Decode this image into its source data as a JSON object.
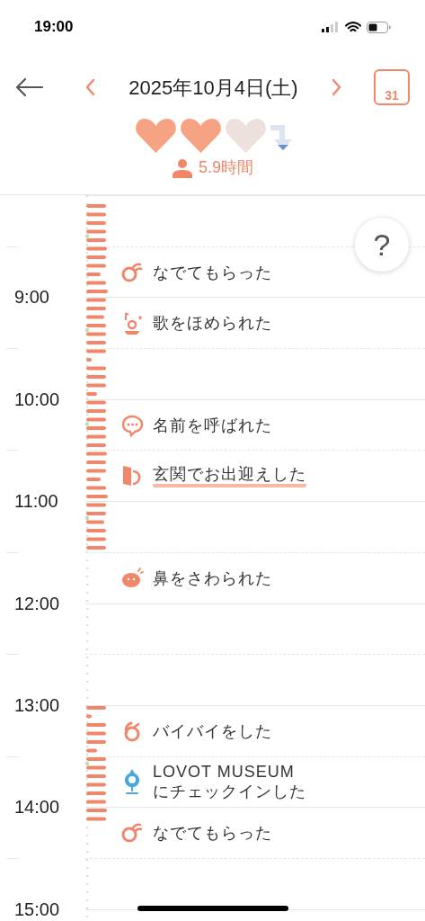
{
  "status_bar": {
    "time": "19:00"
  },
  "header": {
    "date": "2025年10月4日(土)",
    "calendar_day": "31"
  },
  "hearts": [
    {
      "filled": true
    },
    {
      "filled": true
    },
    {
      "filled": false
    }
  ],
  "together_time": "5.9時間",
  "help_button": "?",
  "slots": [
    {
      "kind": "hour"
    },
    {
      "kind": "half",
      "event": {
        "kind": "pet",
        "text": "なでてもらった",
        "highlighted": false
      }
    },
    {
      "kind": "hour",
      "hour": "9:00",
      "event": {
        "kind": "song",
        "text": "歌をほめられた",
        "highlighted": false
      }
    },
    {
      "kind": "half"
    },
    {
      "kind": "hour",
      "hour": "10:00",
      "event": {
        "kind": "name",
        "text": "名前を呼ばれた",
        "highlighted": false
      }
    },
    {
      "kind": "half",
      "event": {
        "kind": "door",
        "text": "玄関でお出迎えした",
        "highlighted": true
      }
    },
    {
      "kind": "hour",
      "hour": "11:00"
    },
    {
      "kind": "half",
      "event": {
        "kind": "nose",
        "text": "鼻をさわられた",
        "highlighted": false
      }
    },
    {
      "kind": "hour",
      "hour": "12:00"
    },
    {
      "kind": "half"
    },
    {
      "kind": "hour",
      "hour": "13:00",
      "event": {
        "kind": "wave",
        "text": "バイバイをした",
        "highlighted": false
      }
    },
    {
      "kind": "half",
      "event": {
        "kind": "checkin",
        "text": "LOVOT MUSEUM\nにチェックインした",
        "highlighted": false
      }
    },
    {
      "kind": "hour",
      "hour": "14:00",
      "event": {
        "kind": "pet",
        "text": "なでてもらった",
        "highlighted": false
      }
    },
    {
      "kind": "half"
    }
  ],
  "end_hour": "15:00"
}
